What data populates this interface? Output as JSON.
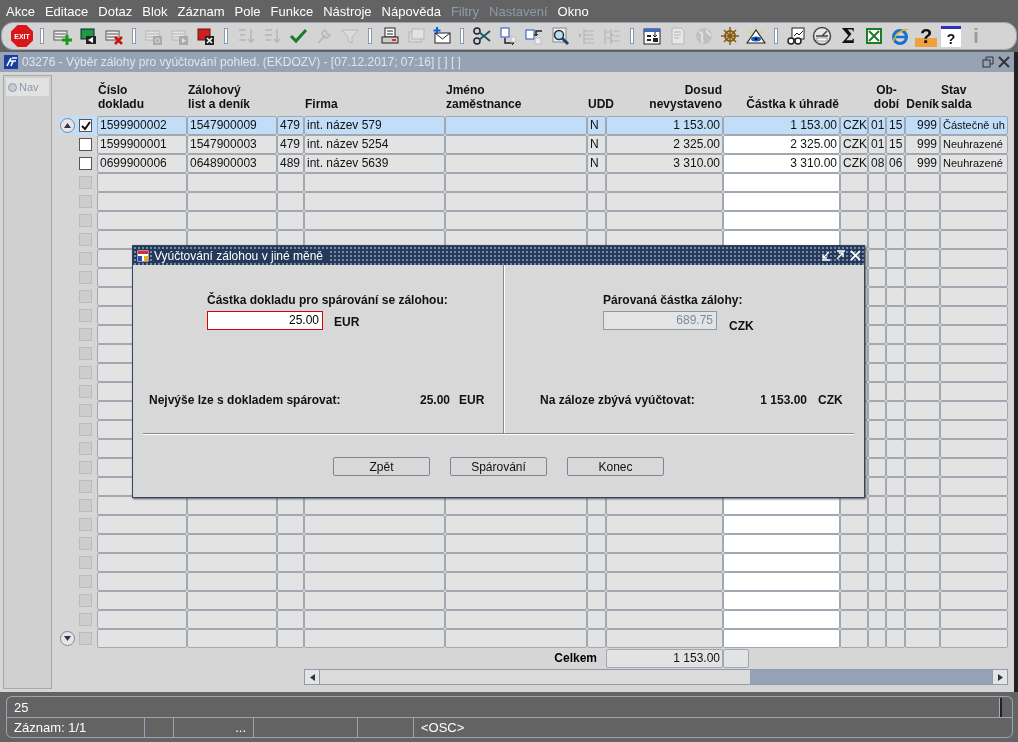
{
  "menu": [
    {
      "label": "Akce",
      "disabled": false
    },
    {
      "label": "Editace",
      "disabled": false
    },
    {
      "label": "Dotaz",
      "disabled": false
    },
    {
      "label": "Blok",
      "disabled": false
    },
    {
      "label": "Záznam",
      "disabled": false
    },
    {
      "label": "Pole",
      "disabled": false
    },
    {
      "label": "Funkce",
      "disabled": false
    },
    {
      "label": "Nástroje",
      "disabled": false
    },
    {
      "label": "Nápověda",
      "disabled": false
    },
    {
      "label": "Filtry",
      "disabled": true
    },
    {
      "label": "Nastavení",
      "disabled": true
    },
    {
      "label": "Okno",
      "disabled": false
    }
  ],
  "toolbar": [
    {
      "kind": "exit",
      "label": "EXIT",
      "disabled": false
    },
    {
      "kind": "separator"
    },
    {
      "kind": "add",
      "disabled": false
    },
    {
      "kind": "save",
      "disabled": false
    },
    {
      "kind": "delete",
      "disabled": false
    },
    {
      "kind": "separator"
    },
    {
      "kind": "query",
      "disabled": true
    },
    {
      "kind": "execute",
      "disabled": true
    },
    {
      "kind": "cancel",
      "disabled": false
    },
    {
      "kind": "separator"
    },
    {
      "kind": "sort_asc",
      "disabled": true
    },
    {
      "kind": "sort_desc",
      "disabled": true
    },
    {
      "kind": "check",
      "disabled": false
    },
    {
      "kind": "wrench",
      "disabled": true
    },
    {
      "kind": "filter",
      "disabled": true
    },
    {
      "kind": "separator"
    },
    {
      "kind": "print",
      "disabled": false
    },
    {
      "kind": "printers",
      "disabled": true
    },
    {
      "kind": "mail",
      "disabled": false
    },
    {
      "kind": "separator"
    },
    {
      "kind": "cut",
      "disabled": false
    },
    {
      "kind": "copy",
      "disabled": false
    },
    {
      "kind": "paste",
      "disabled": false
    },
    {
      "kind": "zoom",
      "disabled": false
    },
    {
      "kind": "list",
      "disabled": true
    },
    {
      "kind": "branch",
      "disabled": true
    },
    {
      "kind": "separator"
    },
    {
      "kind": "form",
      "disabled": false
    },
    {
      "kind": "document",
      "disabled": true
    },
    {
      "kind": "globe",
      "disabled": true
    },
    {
      "kind": "wheel",
      "disabled": false
    },
    {
      "kind": "eye",
      "disabled": false
    },
    {
      "kind": "separator"
    },
    {
      "kind": "glasses",
      "disabled": false
    },
    {
      "kind": "gauge",
      "disabled": false
    },
    {
      "kind": "sum",
      "label": "Σ",
      "disabled": false
    },
    {
      "kind": "spreadsheet",
      "disabled": false
    },
    {
      "kind": "browser",
      "disabled": false
    },
    {
      "kind": "help",
      "label": "?",
      "disabled": false
    },
    {
      "kind": "help_window",
      "label": "?",
      "disabled": false
    },
    {
      "kind": "info",
      "label": "i",
      "disabled": true
    }
  ],
  "window": {
    "title": "03276 - Výběr zálohy pro vyúčtování pohled. (EKDOZV) - [07.12.2017; 07:16] [ ] [ ]",
    "nav": {
      "label": "Nav",
      "selected": false
    }
  },
  "table": {
    "columns": [
      {
        "label": "Číslo\ndokladu",
        "kind": "text",
        "editable": false
      },
      {
        "label": "Zálohový\nlist a deník",
        "kind": "text",
        "editable": false
      },
      {
        "kind": "text",
        "editable": false
      },
      {
        "label": "Firma",
        "kind": "text",
        "editable": false
      },
      {
        "label": "Jméno\nzaměstnance",
        "kind": "text",
        "editable": false
      },
      {
        "label": "UDD",
        "kind": "text",
        "editable": false
      },
      {
        "label": "Dosud\nnevystaveno",
        "kind": "number",
        "editable": false
      },
      {
        "label": "Částka k úhradě",
        "kind": "number",
        "editable": true
      },
      {
        "kind": "text",
        "editable": false
      },
      {
        "label": "Ob-\ndobí",
        "kind": "text",
        "editable": false
      },
      {
        "kind": "text",
        "editable": false
      },
      {
        "label": "Deník",
        "kind": "number",
        "editable": false
      },
      {
        "label": "Stav\nsalda",
        "kind": "text",
        "editable": false
      }
    ],
    "rows": [
      {
        "checked": true,
        "selected": true,
        "cells": [
          "1599900002",
          "1547900009",
          "479",
          "int. název 579",
          null,
          "N",
          "1 153.00",
          "1 153.00",
          "CZK",
          "01",
          "15",
          "999",
          "Částečně uh"
        ]
      },
      {
        "checked": false,
        "selected": false,
        "cells": [
          "1599900001",
          "1547900003",
          "479",
          "int. název 5254",
          null,
          "N",
          "2 325.00",
          "2 325.00",
          "CZK",
          "01",
          "15",
          "999",
          "Neuhrazené"
        ]
      },
      {
        "checked": false,
        "selected": false,
        "cells": [
          "0699900006",
          "0648900003",
          "489",
          "int. název 5639",
          null,
          "N",
          "3 310.00",
          "3 310.00",
          "CZK",
          "08",
          "06",
          "999",
          "Neuhrazené"
        ]
      }
    ],
    "total": {
      "label": "Celkem",
      "value": "1 153.00"
    }
  },
  "dialog": {
    "title": "Vyúčtování zálohou v jiné měně",
    "left": {
      "label": "Částka dokladu pro spárování se zálohou:",
      "value": "25.00",
      "currency": "EUR",
      "focused": true,
      "limit_label": "Nejvýše lze s dokladem spárovat:",
      "limit_value": "25.00",
      "limit_currency": "EUR"
    },
    "right": {
      "label": "Párovaná částka zálohy:",
      "value": "689.75",
      "currency": "CZK",
      "disabled": true,
      "limit_label": "Na záloze zbývá vyúčtovat:",
      "limit_value": "1 153.00",
      "limit_currency": "CZK"
    },
    "buttons": [
      "Zpět",
      "Spárování",
      "Konec"
    ]
  },
  "status_bar": {
    "message": "25",
    "fields": [
      "Záznam: 1/1",
      "...",
      "<OSC>"
    ]
  }
}
